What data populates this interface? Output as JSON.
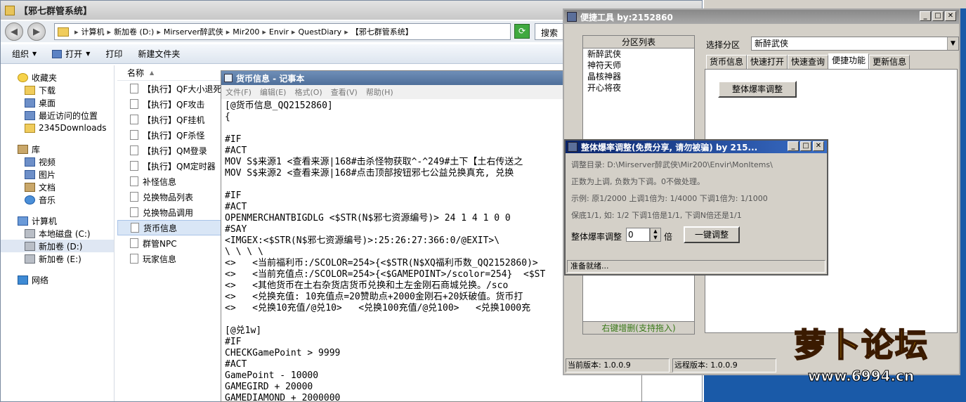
{
  "explorer": {
    "title": "【邪七群管系统】",
    "breadcrumbs": [
      "计算机",
      "新加卷 (D:)",
      "Mirserver醉武侠",
      "Mir200",
      "Envir",
      "QuestDiary",
      "【邪七群管系统】"
    ],
    "search_placeholder": "搜索",
    "toolbar": {
      "organize": "组织",
      "open": "打开",
      "print": "打印",
      "new_folder": "新建文件夹"
    },
    "nav": {
      "favorites": {
        "label": "收藏夹",
        "items": [
          "下载",
          "桌面",
          "最近访问的位置",
          "2345Downloads"
        ]
      },
      "libraries": {
        "label": "库",
        "items": [
          "视频",
          "图片",
          "文档",
          "音乐"
        ]
      },
      "computer": {
        "label": "计算机",
        "items": [
          "本地磁盘 (C:)",
          "新加卷 (D:)",
          "新加卷 (E:)"
        ]
      },
      "network": {
        "label": "网络"
      }
    },
    "column_name": "名称",
    "files": [
      "【执行】QF大小退死",
      "【执行】QF攻击",
      "【执行】QF挂机",
      "【执行】QF杀怪",
      "【执行】QM登录",
      "【执行】QM定时器",
      "补怪信息",
      "兑换物品列表",
      "兑换物品调用",
      "货币信息",
      "群管NPC",
      "玩家信息"
    ]
  },
  "notepad": {
    "title": "货币信息 - 记事本",
    "menu": [
      "文件(F)",
      "编辑(E)",
      "格式(O)",
      "查看(V)",
      "帮助(H)"
    ],
    "lines": [
      "[@货币信息_QQ2152860]",
      "{",
      "",
      "#IF",
      "#ACT",
      "MOV S$来源1 <查看来源|168#击杀怪物获取^-^249#土下【土右传送之",
      "MOV S$来源2 <查看来源|168#点击顶部按钮邪七公益兑换真充, 兑换",
      "",
      "#IF",
      "#ACT",
      "OPENMERCHANTBIGDLG <$STR(N$邪七资源编号)> 24 1 4 1 0 0",
      "#SAY",
      "<IMGEX:<$STR(N$邪七资源编号)>:25:26:27:366:0/@EXIT>\\",
      "\\ \\ \\ \\",
      "<>   <当前福利币:/SCOLOR=254>{<$STR(N$XQ福利币数_QQ2152860)>",
      "<>   <当前充值点:/SCOLOR=254>{<$GAMEPOINT>/scolor=254}  <$ST",
      "<>   <其他货币在土右杂货店货币兑换和土左金刚石商城兑换。/sco",
      "<>   <兑换充值: 10充值点=20赞助点+2000金刚石+20妖破值。货币打",
      "<>   <兑换10充值/@兑10>   <兑换100充值/@兑100>   <兑换1000充",
      "",
      "[@兑1w]",
      "#IF",
      "CHECKGamePoint > 9999",
      "#ACT",
      "GamePoint - 10000",
      "GAMEGIRD + 20000",
      "GAMEDIAMOND + 2000000"
    ]
  },
  "quicktools": {
    "title": "便捷工具   by:2152860",
    "partition_list_header": "分区列表",
    "partitions": [
      "新醉武侠",
      "神符天师",
      "晶核神器",
      "开心将夜"
    ],
    "partition_footer": "右键增删(支持拖入)",
    "select_partition_label": "选择分区",
    "selected_partition": "新醉武侠",
    "tabs": [
      "货币信息",
      "快速打开",
      "快速查询",
      "便捷功能",
      "更新信息"
    ],
    "active_tab": "便捷功能",
    "overall_rate_button": "整体爆率调整",
    "current_version": "当前版本: 1.0.0.9",
    "remote_version": "远程版本: 1.0.0.9"
  },
  "rate_dialog": {
    "title": "整体爆率调整(免费分享, 请勿被骗)  by 215...",
    "dir_line": "调整目录: D:\\Mirserver醉武侠\\Mir200\\Envir\\MonItems\\",
    "hint1": "正数为上调, 负数为下调。0不做处理。",
    "hint2": "示例: 原1/2000 上调1倍为: 1/4000 下调1倍为: 1/1000",
    "hint3": "保底1/1, 如: 1/2 下调1倍是1/1, 下调N倍还是1/1",
    "rate_label": "整体爆率调整",
    "rate_value": "0",
    "rate_unit": "倍",
    "apply_button": "一键调整",
    "status": "准备就绪..."
  },
  "watermark": {
    "main": "萝卜论坛",
    "sub": "www.6994.cn"
  }
}
